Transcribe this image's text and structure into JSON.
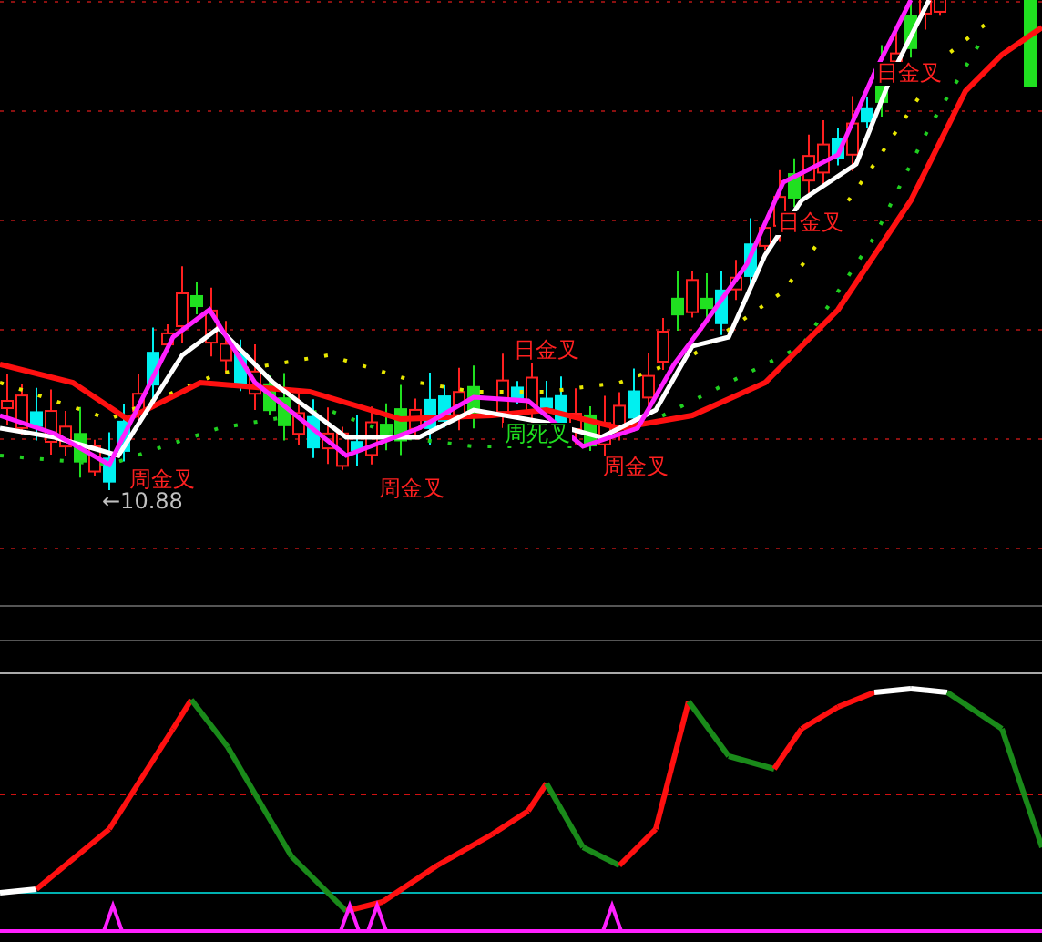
{
  "annotations": [
    {
      "text": "日金叉",
      "kind": "golden_cross"
    },
    {
      "text": "日金叉",
      "kind": "golden_cross"
    },
    {
      "text": "日金叉",
      "kind": "golden_cross"
    },
    {
      "text": "周金叉",
      "kind": "golden_cross"
    },
    {
      "text": "周死叉",
      "kind": "death_cross"
    },
    {
      "text": "周金叉",
      "kind": "golden_cross"
    },
    {
      "text": "周金叉",
      "kind": "golden_cross"
    },
    {
      "text": "←10.88",
      "kind": "low_price"
    }
  ]
}
